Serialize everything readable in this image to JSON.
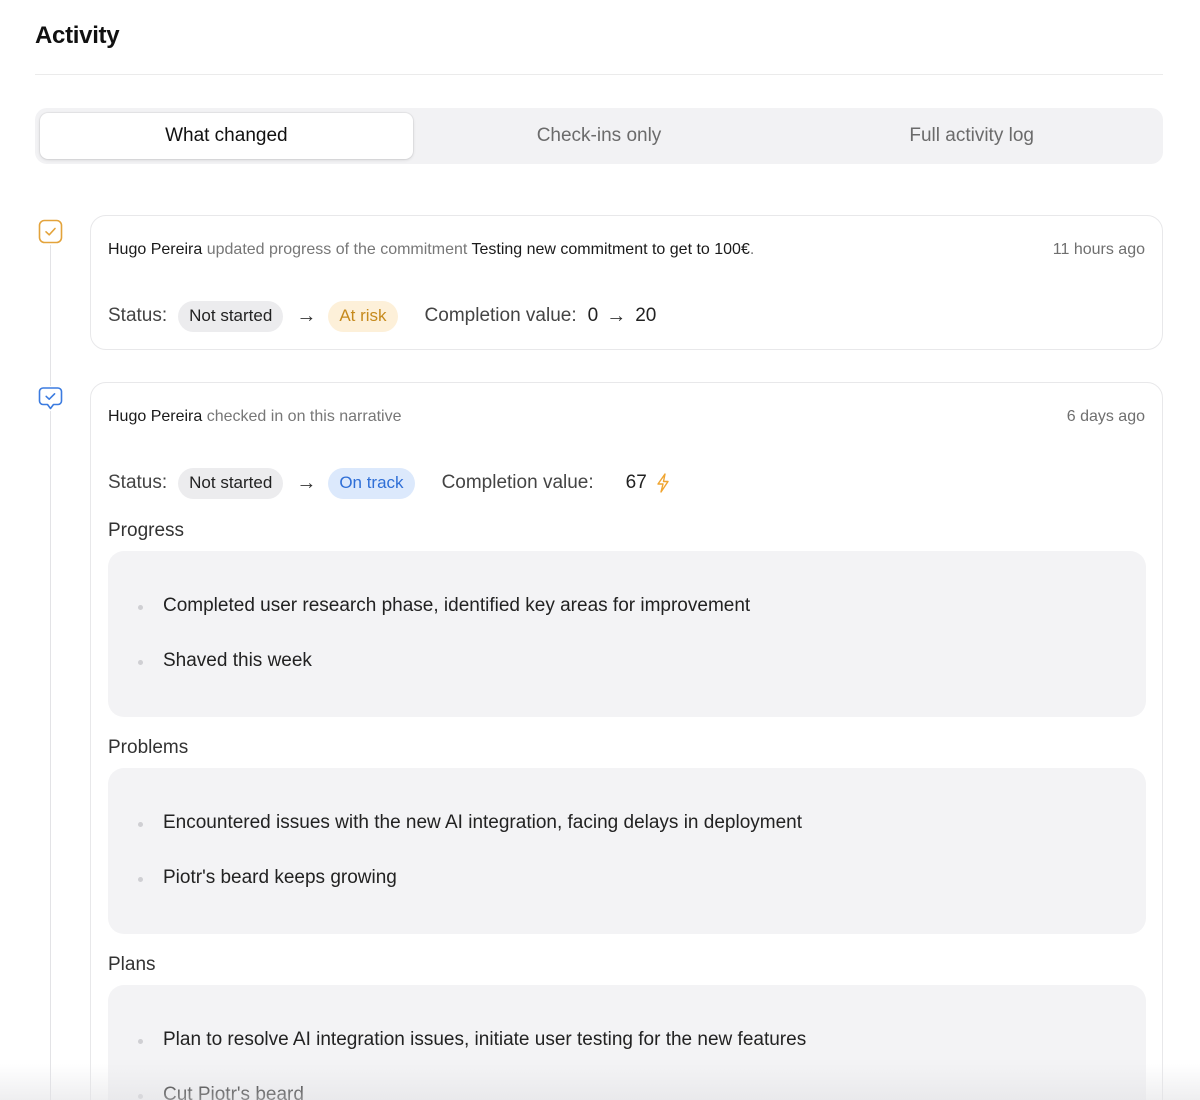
{
  "header": {
    "title": "Activity"
  },
  "tabs": [
    {
      "label": "What changed",
      "active": true
    },
    {
      "label": "Check-ins only",
      "active": false
    },
    {
      "label": "Full activity log",
      "active": false
    }
  ],
  "feed": [
    {
      "actor": "Hugo Pereira",
      "action": "updated progress of the commitment",
      "object": "Testing new commitment to get to 100€",
      "trailing": ".",
      "time": "11 hours ago",
      "icon": "commitment-check-icon",
      "status_label": "Status:",
      "status_from": "Not started",
      "status_to": "At risk",
      "arrow": "→",
      "completion_label": "Completion value:",
      "completion_from": "0",
      "completion_arrow": "→",
      "completion_to": "20"
    },
    {
      "actor": "Hugo Pereira",
      "action": "checked in on this narrative",
      "time": "6 days ago",
      "icon": "checkin-bubble-icon",
      "status_label": "Status:",
      "status_from": "Not started",
      "status_to": "On track",
      "arrow": "→",
      "completion_label": "Completion value:",
      "completion_value": "67",
      "completion_icon": "lightning-icon",
      "sections": [
        {
          "title": "Progress",
          "items": [
            "Completed user research phase, identified key areas for improvement",
            "Shaved this week"
          ]
        },
        {
          "title": "Problems",
          "items": [
            "Encountered issues with the new AI integration, facing delays in deployment",
            "Piotr's beard keeps growing"
          ]
        },
        {
          "title": "Plans",
          "items": [
            "Plan to resolve AI integration issues, initiate user testing for the new features",
            "Cut Piotr's beard"
          ]
        }
      ]
    }
  ],
  "colors": {
    "at_risk_bg": "#fdf0d9",
    "at_risk_text": "#c68a1d",
    "on_track_bg": "#dce9fc",
    "on_track_text": "#2f6fd7",
    "commitment_icon": "#e3a33b",
    "checkin_icon": "#3b7be0",
    "lightning": "#f0a531"
  }
}
